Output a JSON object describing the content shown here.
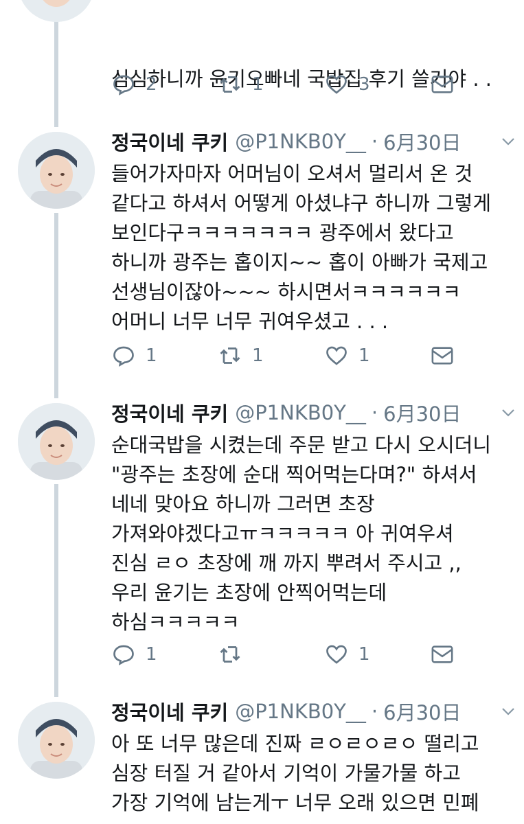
{
  "colors": {
    "thread_line": "#cdd6dd",
    "secondary_text": "#657786",
    "primary_text": "#14171a"
  },
  "top_tweet": {
    "text_line1": "심심하니까 윤기오빠네 국밥집 후기 쓸거야 . .",
    "text_line2": ".",
    "replies": "2",
    "retweets": "1",
    "likes": "3"
  },
  "tweets": [
    {
      "name": "정국이네 쿠키",
      "handle": "@P1NKB0Y__",
      "separator": "·",
      "date": "6月30日",
      "text": "들어가자마자 어머님이 오셔서 멀리서 온 것\n같다고 하셔서 어떻게 아셨냐구 하니까 그렇게\n보인다구ㅋㅋㅋㅋㅋㅋㅋ 광주에서 왔다고\n하니까 광주는 홉이지~~ 홉이 아빠가 국제고\n선생님이잖아~~~ 하시면서ㅋㅋㅋㅋㅋㅋ\n어머니 너무 너무 귀여우셨고 . . .",
      "replies": "1",
      "retweets": "1",
      "likes": "1"
    },
    {
      "name": "정국이네 쿠키",
      "handle": "@P1NKB0Y__",
      "separator": "·",
      "date": "6月30日",
      "text": "순대국밥을 시켰는데 주문 받고 다시 오시더니\n\"광주는 초장에 순대 찍어먹는다며?\" 하셔서\n네네 맞아요 하니까 그러면 초장\n가져와야겠다고ㅠㅋㅋㅋㅋㅋ 아 귀여우셔\n진심 ㄹㅇ 초장에 깨 까지 뿌려서 주시고 ,,\n우리 윤기는 초장에 안찍어먹는데\n하심ㅋㅋㅋㅋㅋ",
      "replies": "1",
      "retweets": "",
      "likes": "1"
    },
    {
      "name": "정국이네 쿠키",
      "handle": "@P1NKB0Y__",
      "separator": "·",
      "date": "6月30日",
      "text": "아 또 너무 많은데 진짜 ㄹㅇㄹㅇㄹㅇ 떨리고\n심장 터질 거 같아서 기억이 가물가물 하고\n가장 기억에 남는게ㅜ 너무 오래 있으면 민폐"
    }
  ],
  "icons": {
    "reply": "reply-icon",
    "retweet": "retweet-icon",
    "like": "heart-icon",
    "dm": "mail-icon",
    "more": "chevron-down-icon"
  }
}
